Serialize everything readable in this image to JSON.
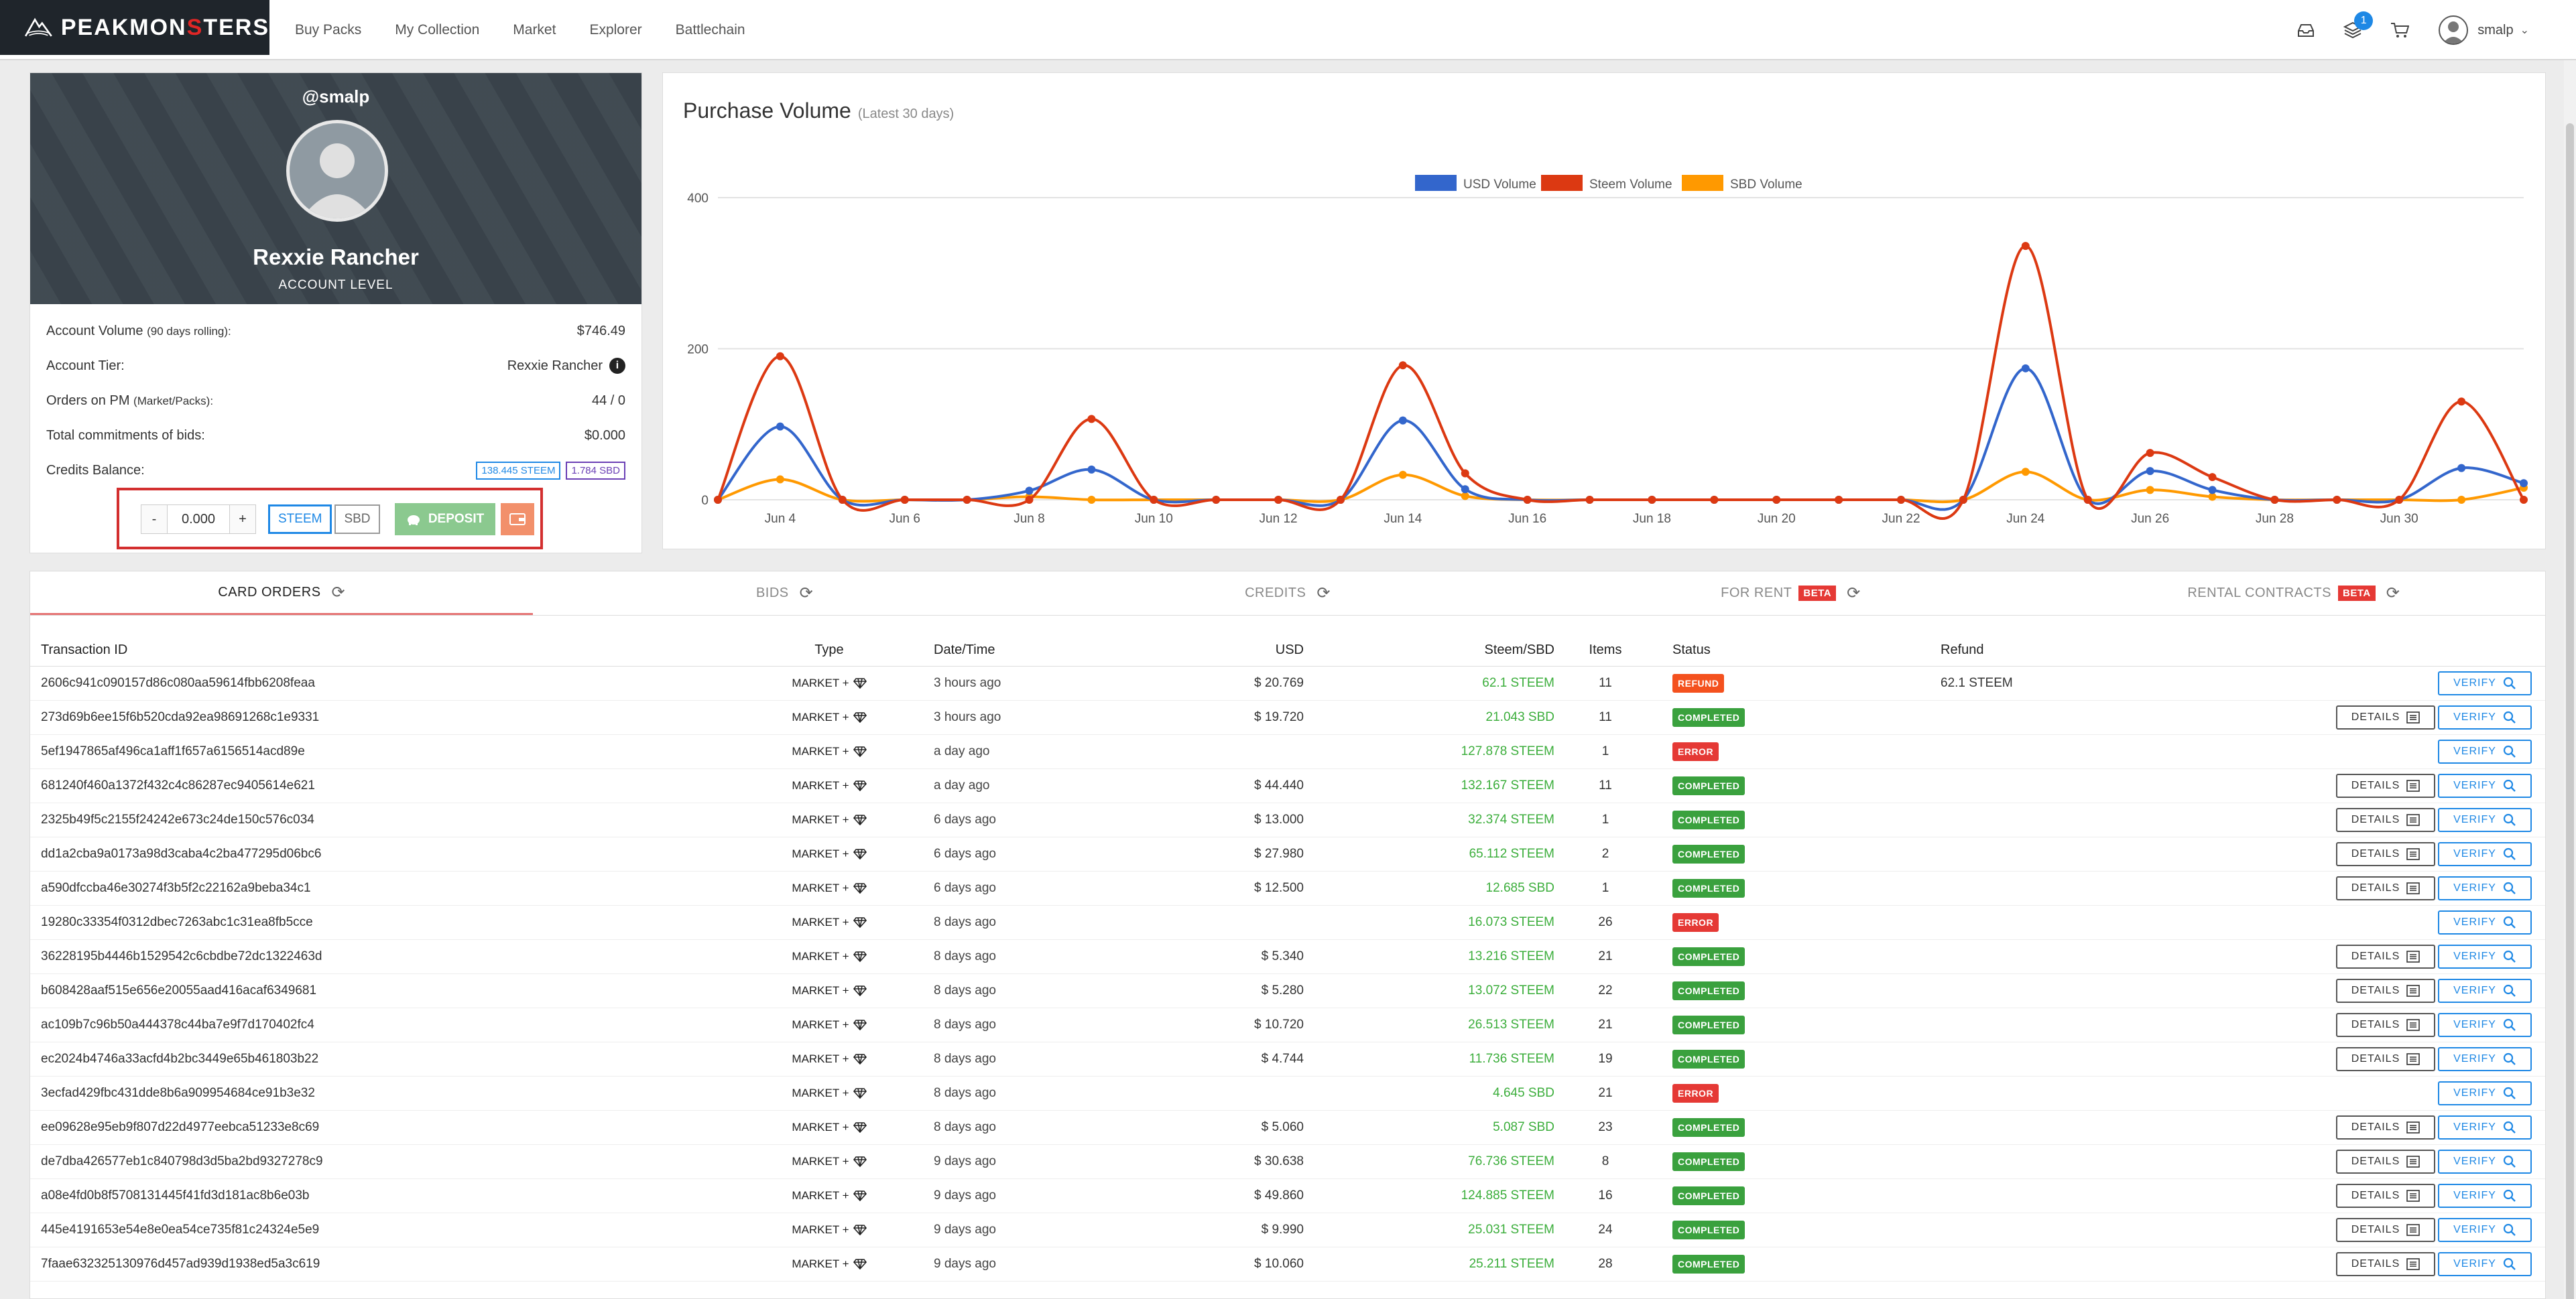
{
  "nav": {
    "logo_pre": "PEAKMON",
    "logo_s": "S",
    "logo_post": "TERS",
    "links": [
      "Buy Packs",
      "My Collection",
      "Market",
      "Explorer",
      "Battlechain"
    ],
    "notification_count": "1",
    "username": "smalp"
  },
  "profile": {
    "handle": "@smalp",
    "tier_name": "Rexxie Rancher",
    "account_level_label": "ACCOUNT LEVEL",
    "stats": {
      "volume_label": "Account Volume",
      "volume_note": "(90 days rolling):",
      "volume_value": "$746.49",
      "tier_label": "Account Tier:",
      "tier_value": "Rexxie Rancher",
      "orders_label": "Orders on PM",
      "orders_note": "(Market/Packs):",
      "orders_value": "44 / 0",
      "bids_label": "Total commitments of bids:",
      "bids_value": "$0.000",
      "credits_label": "Credits Balance:",
      "credits_steem": "138.445 STEEM",
      "credits_sbd": "1.784 SBD"
    },
    "deposit": {
      "minus": "-",
      "amount": "0.000",
      "plus": "+",
      "steem": "STEEM",
      "sbd": "SBD",
      "deposit_label": "DEPOSIT"
    }
  },
  "chart_data": {
    "type": "line",
    "title": "Purchase Volume",
    "subtitle": "(Latest 30 days)",
    "x": [
      "Jun 3",
      "Jun 4",
      "Jun 5",
      "Jun 6",
      "Jun 7",
      "Jun 8",
      "Jun 9",
      "Jun 10",
      "Jun 11",
      "Jun 12",
      "Jun 13",
      "Jun 14",
      "Jun 15",
      "Jun 16",
      "Jun 17",
      "Jun 18",
      "Jun 19",
      "Jun 20",
      "Jun 21",
      "Jun 22",
      "Jun 23",
      "Jun 24",
      "Jun 25",
      "Jun 26",
      "Jun 27",
      "Jun 28",
      "Jun 29",
      "Jun 30",
      "Jul 1",
      "Jul 2"
    ],
    "x_tick_labels": [
      "Jun 4",
      "Jun 6",
      "Jun 8",
      "Jun 10",
      "Jun 12",
      "Jun 14",
      "Jun 16",
      "Jun 18",
      "Jun 20",
      "Jun 22",
      "Jun 24",
      "Jun 26",
      "Jun 28",
      "Jun 30"
    ],
    "y_ticks": [
      "0",
      "200",
      "400"
    ],
    "ylim": [
      0,
      400
    ],
    "legend_position": "top",
    "series": [
      {
        "name": "USD Volume",
        "color": "#3366cc",
        "values": [
          0,
          97,
          0,
          0,
          0,
          12,
          40,
          0,
          0,
          0,
          0,
          105,
          14,
          0,
          0,
          0,
          0,
          0,
          0,
          0,
          0,
          174,
          0,
          38,
          13,
          0,
          0,
          0,
          42,
          22
        ]
      },
      {
        "name": "Steem Volume",
        "color": "#dc3912",
        "values": [
          0,
          190,
          0,
          0,
          0,
          0,
          107,
          0,
          0,
          0,
          0,
          178,
          35,
          0,
          0,
          0,
          0,
          0,
          0,
          0,
          0,
          336,
          0,
          62,
          30,
          0,
          0,
          0,
          130,
          0
        ]
      },
      {
        "name": "SBD Volume",
        "color": "#ff9900",
        "values": [
          0,
          27,
          0,
          0,
          0,
          4,
          0,
          0,
          0,
          0,
          0,
          33,
          5,
          0,
          0,
          0,
          0,
          0,
          0,
          0,
          0,
          37,
          0,
          13,
          4,
          0,
          0,
          0,
          0,
          16
        ]
      }
    ]
  },
  "tabs": [
    {
      "label": "CARD ORDERS",
      "active": true
    },
    {
      "label": "BIDS"
    },
    {
      "label": "CREDITS"
    },
    {
      "label": "FOR RENT",
      "beta": "BETA"
    },
    {
      "label": "RENTAL CONTRACTS",
      "beta": "BETA"
    }
  ],
  "table": {
    "headers": {
      "id": "Transaction ID",
      "type": "Type",
      "date": "Date/Time",
      "usd": "USD",
      "amount": "Steem/SBD",
      "items": "Items",
      "status": "Status",
      "refund": "Refund"
    },
    "details_label": "DETAILS",
    "verify_label": "VERIFY",
    "rows": [
      {
        "id": "2606c941c090157d86c080aa59614fbb6208feaa",
        "type": "MARKET +",
        "date": "3 hours ago",
        "usd": "$ 20.769",
        "amount": "62.1 STEEM",
        "items": "11",
        "status": "REFUND",
        "refund": "62.1 STEEM",
        "details": false
      },
      {
        "id": "273d69b6ee15f6b520cda92ea98691268c1e9331",
        "type": "MARKET +",
        "date": "3 hours ago",
        "usd": "$ 19.720",
        "amount": "21.043 SBD",
        "items": "11",
        "status": "COMPLETED",
        "refund": "",
        "details": true
      },
      {
        "id": "5ef1947865af496ca1aff1f657a6156514acd89e",
        "type": "MARKET +",
        "date": "a day ago",
        "usd": "",
        "amount": "127.878 STEEM",
        "items": "1",
        "status": "ERROR",
        "refund": "",
        "details": false
      },
      {
        "id": "681240f460a1372f432c4c86287ec9405614e621",
        "type": "MARKET +",
        "date": "a day ago",
        "usd": "$ 44.440",
        "amount": "132.167 STEEM",
        "items": "11",
        "status": "COMPLETED",
        "refund": "",
        "details": true
      },
      {
        "id": "2325b49f5c2155f24242e673c24de150c576c034",
        "type": "MARKET +",
        "date": "6 days ago",
        "usd": "$ 13.000",
        "amount": "32.374 STEEM",
        "items": "1",
        "status": "COMPLETED",
        "refund": "",
        "details": true
      },
      {
        "id": "dd1a2cba9a0173a98d3caba4c2ba477295d06bc6",
        "type": "MARKET +",
        "date": "6 days ago",
        "usd": "$ 27.980",
        "amount": "65.112 STEEM",
        "items": "2",
        "status": "COMPLETED",
        "refund": "",
        "details": true
      },
      {
        "id": "a590dfccba46e30274f3b5f2c22162a9beba34c1",
        "type": "MARKET +",
        "date": "6 days ago",
        "usd": "$ 12.500",
        "amount": "12.685 SBD",
        "items": "1",
        "status": "COMPLETED",
        "refund": "",
        "details": true
      },
      {
        "id": "19280c33354f0312dbec7263abc1c31ea8fb5cce",
        "type": "MARKET +",
        "date": "8 days ago",
        "usd": "",
        "amount": "16.073 STEEM",
        "items": "26",
        "status": "ERROR",
        "refund": "",
        "details": false
      },
      {
        "id": "36228195b4446b1529542c6cbdbe72dc1322463d",
        "type": "MARKET +",
        "date": "8 days ago",
        "usd": "$ 5.340",
        "amount": "13.216 STEEM",
        "items": "21",
        "status": "COMPLETED",
        "refund": "",
        "details": true
      },
      {
        "id": "b608428aaf515e656e20055aad416acaf6349681",
        "type": "MARKET +",
        "date": "8 days ago",
        "usd": "$ 5.280",
        "amount": "13.072 STEEM",
        "items": "22",
        "status": "COMPLETED",
        "refund": "",
        "details": true
      },
      {
        "id": "ac109b7c96b50a444378c44ba7e9f7d170402fc4",
        "type": "MARKET +",
        "date": "8 days ago",
        "usd": "$ 10.720",
        "amount": "26.513 STEEM",
        "items": "21",
        "status": "COMPLETED",
        "refund": "",
        "details": true
      },
      {
        "id": "ec2024b4746a33acfd4b2bc3449e65b461803b22",
        "type": "MARKET +",
        "date": "8 days ago",
        "usd": "$ 4.744",
        "amount": "11.736 STEEM",
        "items": "19",
        "status": "COMPLETED",
        "refund": "",
        "details": true
      },
      {
        "id": "3ecfad429fbc431dde8b6a909954684ce91b3e32",
        "type": "MARKET +",
        "date": "8 days ago",
        "usd": "",
        "amount": "4.645 SBD",
        "items": "21",
        "status": "ERROR",
        "refund": "",
        "details": false
      },
      {
        "id": "ee09628e95eb9f807d22d4977eebca51233e8c69",
        "type": "MARKET +",
        "date": "8 days ago",
        "usd": "$ 5.060",
        "amount": "5.087 SBD",
        "items": "23",
        "status": "COMPLETED",
        "refund": "",
        "details": true
      },
      {
        "id": "de7dba426577eb1c840798d3d5ba2bd9327278c9",
        "type": "MARKET +",
        "date": "9 days ago",
        "usd": "$ 30.638",
        "amount": "76.736 STEEM",
        "items": "8",
        "status": "COMPLETED",
        "refund": "",
        "details": true
      },
      {
        "id": "a08e4fd0b8f5708131445f41fd3d181ac8b6e03b",
        "type": "MARKET +",
        "date": "9 days ago",
        "usd": "$ 49.860",
        "amount": "124.885 STEEM",
        "items": "16",
        "status": "COMPLETED",
        "refund": "",
        "details": true
      },
      {
        "id": "445e4191653e54e8e0ea54ce735f81c24324e5e9",
        "type": "MARKET +",
        "date": "9 days ago",
        "usd": "$ 9.990",
        "amount": "25.031 STEEM",
        "items": "24",
        "status": "COMPLETED",
        "refund": "",
        "details": true
      },
      {
        "id": "7faae632325130976d457ad939d1938ed5a3c619",
        "type": "MARKET +",
        "date": "9 days ago",
        "usd": "$ 10.060",
        "amount": "25.211 STEEM",
        "items": "28",
        "status": "COMPLETED",
        "refund": "",
        "details": true
      }
    ]
  }
}
